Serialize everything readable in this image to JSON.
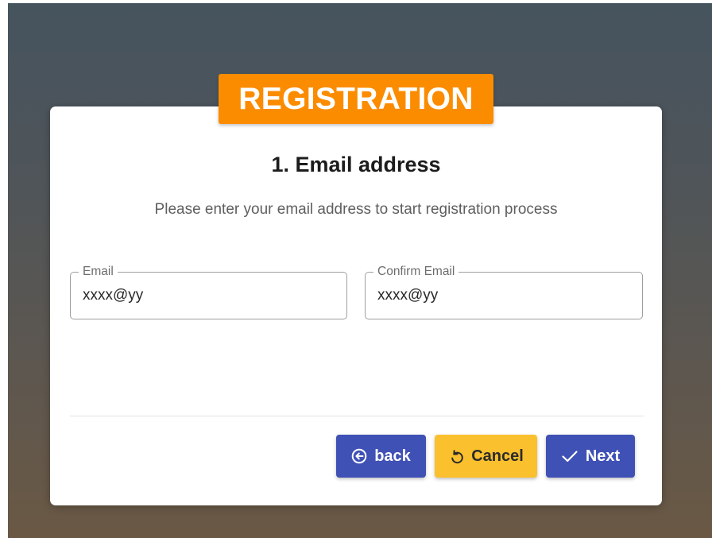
{
  "badge": {
    "text": "REGISTRATION"
  },
  "step": {
    "title": "1. Email address",
    "subtitle": "Please enter your email address to start registration process"
  },
  "fields": {
    "email": {
      "label": "Email",
      "value": "xxxx@yy"
    },
    "confirm_email": {
      "label": "Confirm Email",
      "value": "xxxx@yy"
    }
  },
  "buttons": {
    "back": {
      "label": "back",
      "icon": "arrow-circle-left-icon"
    },
    "cancel": {
      "label": "Cancel",
      "icon": "undo-icon"
    },
    "next": {
      "label": "Next",
      "icon": "check-icon"
    }
  },
  "colors": {
    "badge": "#fb8c00",
    "primary": "#3f51b5",
    "warning": "#fbc02d"
  }
}
